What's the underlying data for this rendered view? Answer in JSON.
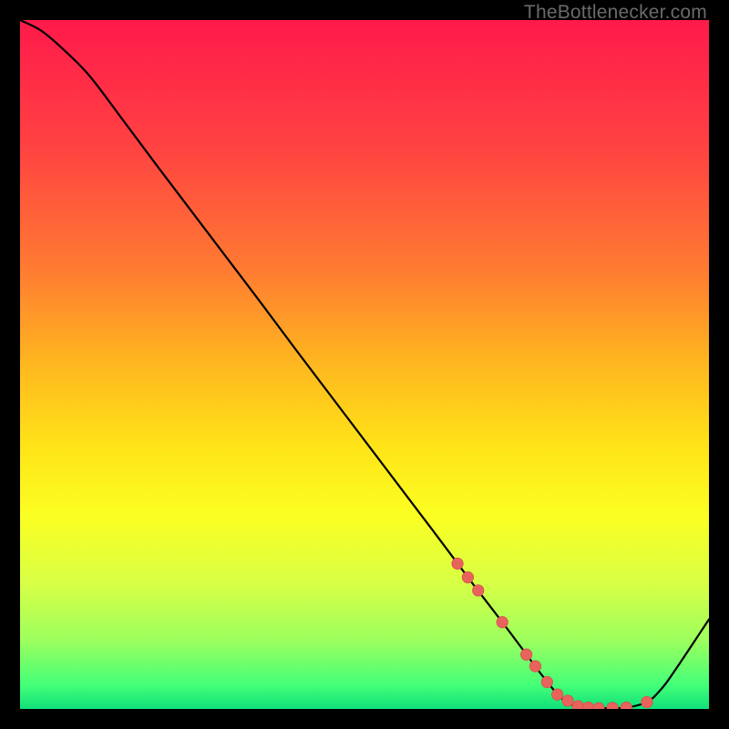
{
  "watermark": "TheBottlenecker.com",
  "colors": {
    "frame": "#000000",
    "curve": "#000000",
    "marker_fill": "#e9635d",
    "marker_stroke": "#d4514a",
    "gradient_stops": [
      {
        "offset": 0.0,
        "color": "#ff1a4b"
      },
      {
        "offset": 0.18,
        "color": "#ff4142"
      },
      {
        "offset": 0.36,
        "color": "#ff7a32"
      },
      {
        "offset": 0.5,
        "color": "#ffb71f"
      },
      {
        "offset": 0.62,
        "color": "#ffe418"
      },
      {
        "offset": 0.72,
        "color": "#fbff22"
      },
      {
        "offset": 0.82,
        "color": "#d6ff46"
      },
      {
        "offset": 0.9,
        "color": "#9dff5e"
      },
      {
        "offset": 0.965,
        "color": "#44ff78"
      },
      {
        "offset": 1.0,
        "color": "#10e07a"
      }
    ]
  },
  "chart_data": {
    "type": "line",
    "title": "",
    "xlabel": "",
    "ylabel": "",
    "xlim": [
      0,
      100
    ],
    "ylim": [
      0,
      100
    ],
    "series": [
      {
        "name": "bottleneck-curve",
        "x": [
          0,
          3,
          6,
          10,
          15,
          20,
          25,
          30,
          35,
          40,
          45,
          50,
          55,
          60,
          63,
          66,
          70,
          73,
          76,
          79,
          82,
          85,
          88,
          91,
          93,
          95,
          100
        ],
        "y": [
          100,
          98.5,
          96,
          92,
          85.4,
          78.7,
          72.1,
          65.5,
          58.9,
          52.2,
          45.6,
          39.0,
          32.4,
          25.8,
          21.8,
          17.8,
          12.6,
          8.6,
          4.6,
          1.2,
          0.2,
          0.1,
          0.2,
          1.0,
          2.8,
          5.5,
          13.0
        ]
      }
    ],
    "markers": {
      "name": "highlight-points",
      "x": [
        63.5,
        65.0,
        66.5,
        70.0,
        73.5,
        74.8,
        76.5,
        78.0,
        79.5,
        81.0,
        82.5,
        84.0,
        86.0,
        88.0,
        91.0
      ],
      "y": [
        21.1,
        19.1,
        17.2,
        12.6,
        7.9,
        6.2,
        3.9,
        2.1,
        1.2,
        0.4,
        0.2,
        0.1,
        0.15,
        0.2,
        1.0
      ]
    }
  }
}
